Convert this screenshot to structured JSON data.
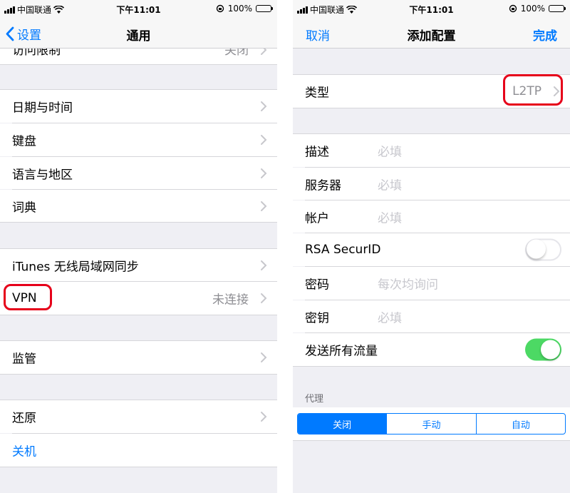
{
  "left": {
    "status": {
      "carrier": "中国联通",
      "time": "下午11:01",
      "battery": "100%"
    },
    "nav": {
      "back_label": "设置",
      "title": "通用"
    },
    "partial_row": {
      "label": "访问限制",
      "value": "关闭"
    },
    "rows": [
      {
        "label": "日期与时间"
      },
      {
        "label": "键盘"
      },
      {
        "label": "语言与地区"
      },
      {
        "label": "词典"
      },
      {
        "label": "iTunes 无线局域网同步"
      },
      {
        "label": "VPN",
        "value": "未连接"
      },
      {
        "label": "监管"
      },
      {
        "label": "还原"
      },
      {
        "label": "关机"
      }
    ]
  },
  "right": {
    "status": {
      "carrier": "中国联通",
      "time": "下午11:01",
      "battery": "100%"
    },
    "nav": {
      "cancel_label": "取消",
      "title": "添加配置",
      "done_label": "完成"
    },
    "type_row": {
      "label": "类型",
      "value": "L2TP"
    },
    "fields": [
      {
        "label": "描述",
        "placeholder": "必填"
      },
      {
        "label": "服务器",
        "placeholder": "必填"
      },
      {
        "label": "帐户",
        "placeholder": "必填"
      },
      {
        "label": "RSA SecurID",
        "toggle": false
      },
      {
        "label": "密码",
        "placeholder": "每次均询问"
      },
      {
        "label": "密钥",
        "placeholder": "必填"
      },
      {
        "label": "发送所有流量",
        "toggle": true
      }
    ],
    "proxy": {
      "header": "代理",
      "options": [
        "关闭",
        "手动",
        "自动"
      ],
      "selected": 0
    }
  },
  "colors": {
    "accent": "#007aff",
    "highlight": "#e6001a",
    "toggle_on": "#4cd964",
    "group_bg": "#efeff4"
  }
}
